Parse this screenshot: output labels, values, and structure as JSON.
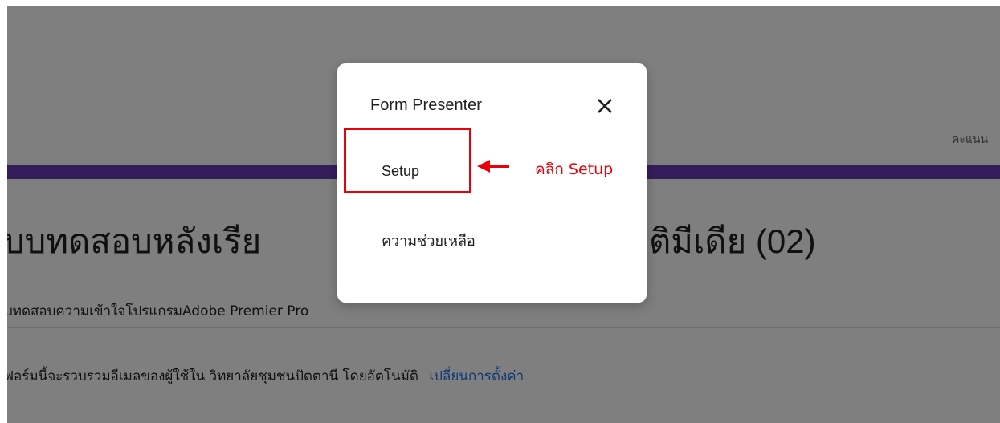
{
  "form": {
    "score_label": "คะแนน",
    "title_head": "บบทดสอบหลังเรีย",
    "title_tail": "ติมีเดีย (02)",
    "description": "บทดสอบความเข้าใจโปรแกรมAdobe Premier Pro",
    "collect_note": "ฟอร์มนี้จะรวบรวมอีเมลของผู้ใช้ใน วิทยาลัยชุมชนปัตตานี โดยอัตโนมัติ",
    "change_settings_link": "เปลี่ยนการตั้งค่า",
    "accent_color": "#673ab7"
  },
  "dialog": {
    "title": "Form Presenter",
    "close_icon": "close-icon",
    "items": [
      {
        "label": "Setup"
      },
      {
        "label": "ความช่วยเหลือ"
      }
    ]
  },
  "annotation": {
    "text": "คลิก Setup",
    "color": "#e8000b"
  }
}
